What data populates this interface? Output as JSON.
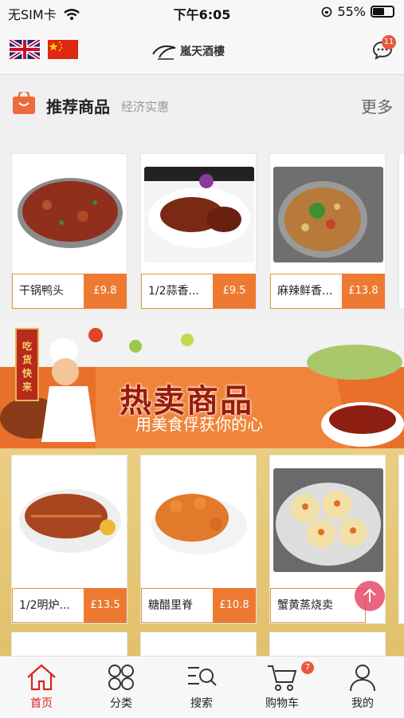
{
  "status_bar": {
    "carrier": "无SIM卡",
    "time": "下午6:05",
    "battery": "55%"
  },
  "header": {
    "logo_text": "嵐天酒樓",
    "message_count": "11"
  },
  "recommended": {
    "title": "推荐商品",
    "subtitle": "经济实惠",
    "more": "更多",
    "items": [
      {
        "name": "干锅鸭头",
        "price": "£9.8"
      },
      {
        "name": "1/2蒜香...",
        "price": "£9.5"
      },
      {
        "name": "麻辣鲜香...",
        "price": "£13.8"
      }
    ]
  },
  "banner": {
    "sign": "吃货快来",
    "title": "热卖商品",
    "subtitle": "用美食俘获你的心"
  },
  "hot": {
    "items": [
      {
        "name": "1/2明炉...",
        "price": "£13.5"
      },
      {
        "name": "糖醋里脊",
        "price": "£10.8"
      },
      {
        "name": "蟹黄蒸烧卖",
        "price": ""
      }
    ]
  },
  "nav": {
    "home": "首页",
    "category": "分类",
    "search": "搜索",
    "cart": "购物车",
    "cart_count": "7",
    "mine": "我的"
  },
  "colors": {
    "accent": "#ee7a32",
    "active": "#d9261c"
  }
}
